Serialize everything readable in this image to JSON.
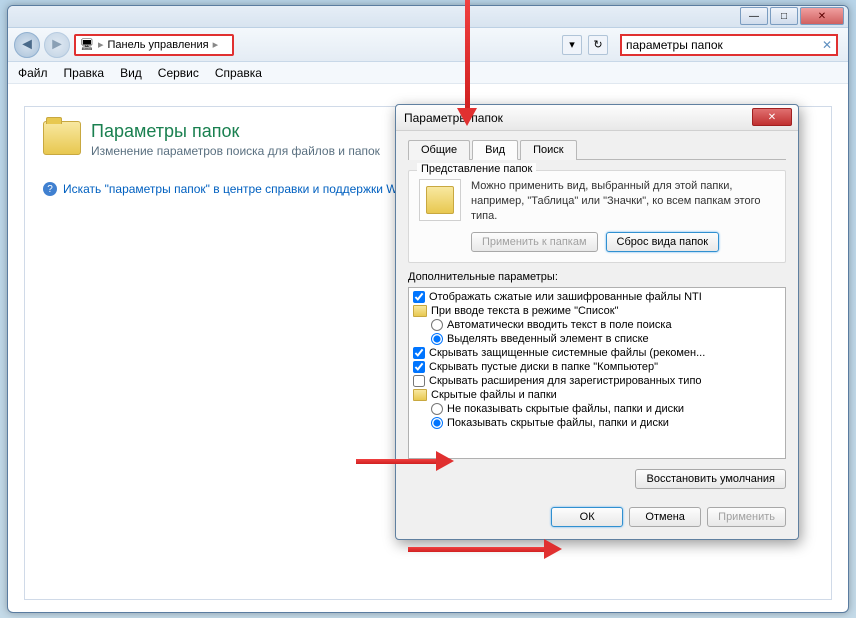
{
  "window": {
    "breadcrumb_icon": "▸",
    "breadcrumb_label": "Панель управления",
    "search_value": "параметры папок"
  },
  "menu": {
    "file": "Файл",
    "edit": "Правка",
    "view": "Вид",
    "tools": "Сервис",
    "help": "Справка"
  },
  "page": {
    "title": "Параметры папок",
    "subtitle": "Изменение параметров поиска для файлов и папок",
    "help_link": "Искать \"параметры папок\" в центре справки и поддержки Win"
  },
  "dialog": {
    "title": "Параметры папок",
    "tabs": {
      "general": "Общие",
      "view": "Вид",
      "search": "Поиск"
    },
    "group1": {
      "legend": "Представление папок",
      "text": "Можно применить вид, выбранный для этой папки, например, \"Таблица\" или \"Значки\", ко всем папкам этого типа.",
      "apply_btn": "Применить к папкам",
      "reset_btn": "Сброс вида папок"
    },
    "params_label": "Дополнительные параметры:",
    "items": [
      {
        "type": "check",
        "checked": true,
        "text": "Отображать сжатые или зашифрованные файлы NTI"
      },
      {
        "type": "folder",
        "text": "При вводе текста в режиме \"Список\""
      },
      {
        "type": "radio",
        "indent": true,
        "checked": false,
        "text": "Автоматически вводить текст в поле поиска"
      },
      {
        "type": "radio",
        "indent": true,
        "checked": true,
        "text": "Выделять введенный элемент в списке"
      },
      {
        "type": "check",
        "checked": true,
        "text": "Скрывать защищенные системные файлы (рекомен..."
      },
      {
        "type": "check",
        "checked": true,
        "text": "Скрывать пустые диски в папке \"Компьютер\""
      },
      {
        "type": "check",
        "checked": false,
        "text": "Скрывать расширения для зарегистрированных типо"
      },
      {
        "type": "folder",
        "text": "Скрытые файлы и папки"
      },
      {
        "type": "radio",
        "indent": true,
        "checked": false,
        "text": "Не показывать скрытые файлы, папки и диски"
      },
      {
        "type": "radio",
        "indent": true,
        "checked": true,
        "text": "Показывать скрытые файлы, папки и диски"
      }
    ],
    "restore_btn": "Восстановить умолчания",
    "ok": "ОК",
    "cancel": "Отмена",
    "apply": "Применить"
  }
}
